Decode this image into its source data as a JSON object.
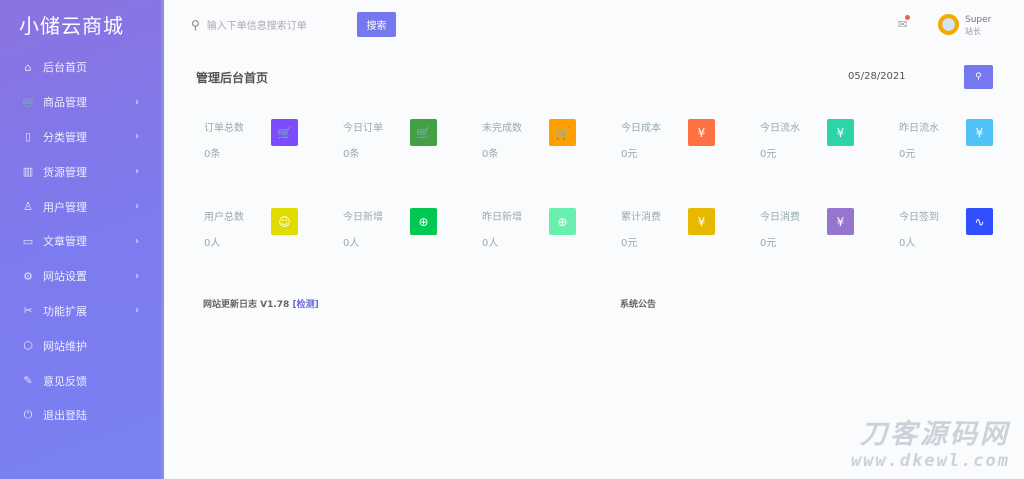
{
  "app": {
    "title": "小储云商城"
  },
  "sidebar": {
    "items": [
      {
        "label": "后台首页",
        "icon": "home-icon",
        "glyph": "⌂",
        "chev": false
      },
      {
        "label": "商品管理",
        "icon": "cart-icon",
        "glyph": "🛒",
        "chev": true
      },
      {
        "label": "分类管理",
        "icon": "category-icon",
        "glyph": "▯",
        "chev": true
      },
      {
        "label": "货源管理",
        "icon": "source-icon",
        "glyph": "▥",
        "chev": true
      },
      {
        "label": "用户管理",
        "icon": "user-icon",
        "glyph": "♙",
        "chev": true
      },
      {
        "label": "文章管理",
        "icon": "book-icon",
        "glyph": "▭",
        "chev": true
      },
      {
        "label": "网站设置",
        "icon": "gear-icon",
        "glyph": "⚙",
        "chev": true
      },
      {
        "label": "功能扩展",
        "icon": "extension-icon",
        "glyph": "✂",
        "chev": true
      },
      {
        "label": "网站维护",
        "icon": "box-icon",
        "glyph": "⬡",
        "chev": false
      },
      {
        "label": "意见反馈",
        "icon": "feedback-icon",
        "glyph": "✎",
        "chev": false
      },
      {
        "label": "退出登陆",
        "icon": "power-icon",
        "glyph": "⏻",
        "chev": false
      }
    ]
  },
  "search": {
    "placeholder": "输入下单信息搜索订单",
    "button": "搜索"
  },
  "user": {
    "name": "Super",
    "role": "站长"
  },
  "page": {
    "title": "管理后台首页",
    "date": "05/28/2021"
  },
  "stats": [
    {
      "label": "订单总数",
      "value": "0条",
      "color": "#7b4dff",
      "glyph": "🛒"
    },
    {
      "label": "今日订单",
      "value": "0条",
      "color": "#43a047",
      "glyph": "🛒"
    },
    {
      "label": "未完成数",
      "value": "0条",
      "color": "#ffa000",
      "glyph": "🛒"
    },
    {
      "label": "今日成本",
      "value": "0元",
      "color": "#ff7043",
      "glyph": "¥"
    },
    {
      "label": "今日流水",
      "value": "0元",
      "color": "#2ed3a8",
      "glyph": "¥"
    },
    {
      "label": "昨日流水",
      "value": "0元",
      "color": "#4fc3f7",
      "glyph": "¥"
    },
    {
      "label": "用户总数",
      "value": "0人",
      "color": "#e0dc00",
      "glyph": "☺"
    },
    {
      "label": "今日新增",
      "value": "0人",
      "color": "#00c853",
      "glyph": "⊕"
    },
    {
      "label": "昨日新增",
      "value": "0人",
      "color": "#69f0ae",
      "glyph": "⊕"
    },
    {
      "label": "累计消费",
      "value": "0元",
      "color": "#e6b800",
      "glyph": "¥"
    },
    {
      "label": "今日消费",
      "value": "0元",
      "color": "#9575cd",
      "glyph": "¥"
    },
    {
      "label": "今日签到",
      "value": "0人",
      "color": "#304ffe",
      "glyph": "∿"
    }
  ],
  "sections": {
    "changelog": "网站更新日志 V1.78",
    "check": "[检测]",
    "notice": "系统公告"
  },
  "watermark": {
    "title": "刀客源码网",
    "url": "www.dkewl.com"
  }
}
